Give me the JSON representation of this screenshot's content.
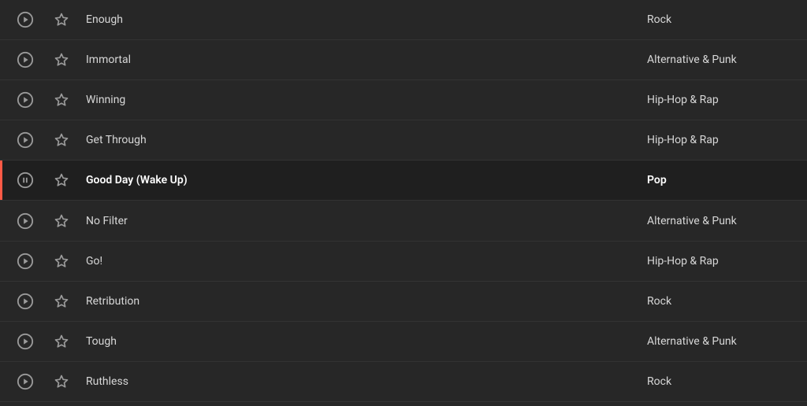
{
  "colors": {
    "accent": "#ff5a46",
    "bg": "#272727",
    "bg_active": "#1f1f1f",
    "text": "#d7d7d7",
    "icon": "#9a9a9a"
  },
  "tracks": [
    {
      "title": "Enough",
      "genre": "Rock",
      "playing": false,
      "favorite": false
    },
    {
      "title": "Immortal",
      "genre": "Alternative & Punk",
      "playing": false,
      "favorite": false
    },
    {
      "title": "Winning",
      "genre": "Hip-Hop & Rap",
      "playing": false,
      "favorite": false
    },
    {
      "title": "Get Through",
      "genre": "Hip-Hop & Rap",
      "playing": false,
      "favorite": false
    },
    {
      "title": "Good Day (Wake Up)",
      "genre": "Pop",
      "playing": true,
      "favorite": false
    },
    {
      "title": "No Filter",
      "genre": "Alternative & Punk",
      "playing": false,
      "favorite": false
    },
    {
      "title": "Go!",
      "genre": "Hip-Hop & Rap",
      "playing": false,
      "favorite": false
    },
    {
      "title": "Retribution",
      "genre": "Rock",
      "playing": false,
      "favorite": false
    },
    {
      "title": "Tough",
      "genre": "Alternative & Punk",
      "playing": false,
      "favorite": false
    },
    {
      "title": "Ruthless",
      "genre": "Rock",
      "playing": false,
      "favorite": false
    }
  ]
}
